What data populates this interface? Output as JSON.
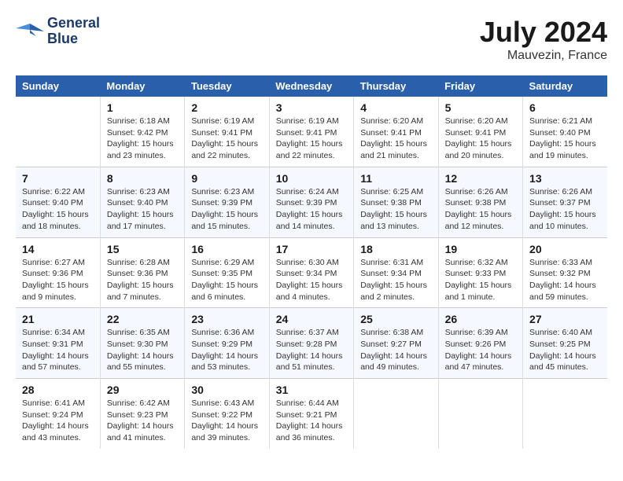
{
  "header": {
    "logo_line1": "General",
    "logo_line2": "Blue",
    "month_year": "July 2024",
    "location": "Mauvezin, France"
  },
  "columns": [
    "Sunday",
    "Monday",
    "Tuesday",
    "Wednesday",
    "Thursday",
    "Friday",
    "Saturday"
  ],
  "weeks": [
    [
      {
        "day": "",
        "sunrise": "",
        "sunset": "",
        "daylight": ""
      },
      {
        "day": "1",
        "sunrise": "Sunrise: 6:18 AM",
        "sunset": "Sunset: 9:42 PM",
        "daylight": "Daylight: 15 hours and 23 minutes."
      },
      {
        "day": "2",
        "sunrise": "Sunrise: 6:19 AM",
        "sunset": "Sunset: 9:41 PM",
        "daylight": "Daylight: 15 hours and 22 minutes."
      },
      {
        "day": "3",
        "sunrise": "Sunrise: 6:19 AM",
        "sunset": "Sunset: 9:41 PM",
        "daylight": "Daylight: 15 hours and 22 minutes."
      },
      {
        "day": "4",
        "sunrise": "Sunrise: 6:20 AM",
        "sunset": "Sunset: 9:41 PM",
        "daylight": "Daylight: 15 hours and 21 minutes."
      },
      {
        "day": "5",
        "sunrise": "Sunrise: 6:20 AM",
        "sunset": "Sunset: 9:41 PM",
        "daylight": "Daylight: 15 hours and 20 minutes."
      },
      {
        "day": "6",
        "sunrise": "Sunrise: 6:21 AM",
        "sunset": "Sunset: 9:40 PM",
        "daylight": "Daylight: 15 hours and 19 minutes."
      }
    ],
    [
      {
        "day": "7",
        "sunrise": "Sunrise: 6:22 AM",
        "sunset": "Sunset: 9:40 PM",
        "daylight": "Daylight: 15 hours and 18 minutes."
      },
      {
        "day": "8",
        "sunrise": "Sunrise: 6:23 AM",
        "sunset": "Sunset: 9:40 PM",
        "daylight": "Daylight: 15 hours and 17 minutes."
      },
      {
        "day": "9",
        "sunrise": "Sunrise: 6:23 AM",
        "sunset": "Sunset: 9:39 PM",
        "daylight": "Daylight: 15 hours and 15 minutes."
      },
      {
        "day": "10",
        "sunrise": "Sunrise: 6:24 AM",
        "sunset": "Sunset: 9:39 PM",
        "daylight": "Daylight: 15 hours and 14 minutes."
      },
      {
        "day": "11",
        "sunrise": "Sunrise: 6:25 AM",
        "sunset": "Sunset: 9:38 PM",
        "daylight": "Daylight: 15 hours and 13 minutes."
      },
      {
        "day": "12",
        "sunrise": "Sunrise: 6:26 AM",
        "sunset": "Sunset: 9:38 PM",
        "daylight": "Daylight: 15 hours and 12 minutes."
      },
      {
        "day": "13",
        "sunrise": "Sunrise: 6:26 AM",
        "sunset": "Sunset: 9:37 PM",
        "daylight": "Daylight: 15 hours and 10 minutes."
      }
    ],
    [
      {
        "day": "14",
        "sunrise": "Sunrise: 6:27 AM",
        "sunset": "Sunset: 9:36 PM",
        "daylight": "Daylight: 15 hours and 9 minutes."
      },
      {
        "day": "15",
        "sunrise": "Sunrise: 6:28 AM",
        "sunset": "Sunset: 9:36 PM",
        "daylight": "Daylight: 15 hours and 7 minutes."
      },
      {
        "day": "16",
        "sunrise": "Sunrise: 6:29 AM",
        "sunset": "Sunset: 9:35 PM",
        "daylight": "Daylight: 15 hours and 6 minutes."
      },
      {
        "day": "17",
        "sunrise": "Sunrise: 6:30 AM",
        "sunset": "Sunset: 9:34 PM",
        "daylight": "Daylight: 15 hours and 4 minutes."
      },
      {
        "day": "18",
        "sunrise": "Sunrise: 6:31 AM",
        "sunset": "Sunset: 9:34 PM",
        "daylight": "Daylight: 15 hours and 2 minutes."
      },
      {
        "day": "19",
        "sunrise": "Sunrise: 6:32 AM",
        "sunset": "Sunset: 9:33 PM",
        "daylight": "Daylight: 15 hours and 1 minute."
      },
      {
        "day": "20",
        "sunrise": "Sunrise: 6:33 AM",
        "sunset": "Sunset: 9:32 PM",
        "daylight": "Daylight: 14 hours and 59 minutes."
      }
    ],
    [
      {
        "day": "21",
        "sunrise": "Sunrise: 6:34 AM",
        "sunset": "Sunset: 9:31 PM",
        "daylight": "Daylight: 14 hours and 57 minutes."
      },
      {
        "day": "22",
        "sunrise": "Sunrise: 6:35 AM",
        "sunset": "Sunset: 9:30 PM",
        "daylight": "Daylight: 14 hours and 55 minutes."
      },
      {
        "day": "23",
        "sunrise": "Sunrise: 6:36 AM",
        "sunset": "Sunset: 9:29 PM",
        "daylight": "Daylight: 14 hours and 53 minutes."
      },
      {
        "day": "24",
        "sunrise": "Sunrise: 6:37 AM",
        "sunset": "Sunset: 9:28 PM",
        "daylight": "Daylight: 14 hours and 51 minutes."
      },
      {
        "day": "25",
        "sunrise": "Sunrise: 6:38 AM",
        "sunset": "Sunset: 9:27 PM",
        "daylight": "Daylight: 14 hours and 49 minutes."
      },
      {
        "day": "26",
        "sunrise": "Sunrise: 6:39 AM",
        "sunset": "Sunset: 9:26 PM",
        "daylight": "Daylight: 14 hours and 47 minutes."
      },
      {
        "day": "27",
        "sunrise": "Sunrise: 6:40 AM",
        "sunset": "Sunset: 9:25 PM",
        "daylight": "Daylight: 14 hours and 45 minutes."
      }
    ],
    [
      {
        "day": "28",
        "sunrise": "Sunrise: 6:41 AM",
        "sunset": "Sunset: 9:24 PM",
        "daylight": "Daylight: 14 hours and 43 minutes."
      },
      {
        "day": "29",
        "sunrise": "Sunrise: 6:42 AM",
        "sunset": "Sunset: 9:23 PM",
        "daylight": "Daylight: 14 hours and 41 minutes."
      },
      {
        "day": "30",
        "sunrise": "Sunrise: 6:43 AM",
        "sunset": "Sunset: 9:22 PM",
        "daylight": "Daylight: 14 hours and 39 minutes."
      },
      {
        "day": "31",
        "sunrise": "Sunrise: 6:44 AM",
        "sunset": "Sunset: 9:21 PM",
        "daylight": "Daylight: 14 hours and 36 minutes."
      },
      {
        "day": "",
        "sunrise": "",
        "sunset": "",
        "daylight": ""
      },
      {
        "day": "",
        "sunrise": "",
        "sunset": "",
        "daylight": ""
      },
      {
        "day": "",
        "sunrise": "",
        "sunset": "",
        "daylight": ""
      }
    ]
  ]
}
